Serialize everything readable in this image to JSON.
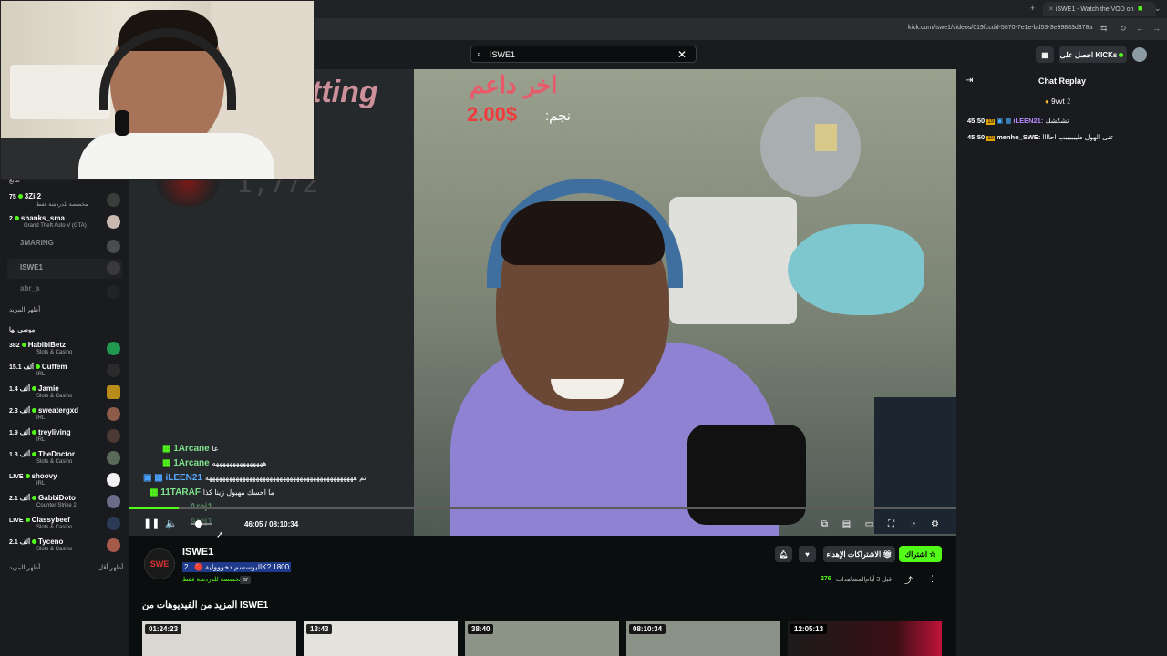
{
  "browser": {
    "tab_title": "iSWE1 - Watch the VOD on",
    "url": "kick.com/iswe1/videos/019fccdd-5870-7e1e-bd53-3e99883d378a"
  },
  "header": {
    "search_value": "ISWE1",
    "get_kicks_label": "احصل على KICKs"
  },
  "sidebar": {
    "following_header": "تتابع",
    "following": [
      {
        "viewers": "75",
        "name": "3Zil2",
        "category": "مخصصة للدردشة فقط"
      },
      {
        "viewers": "2",
        "name": "shanks_sma",
        "category": "Grand Theft Auto V (GTA)"
      },
      {
        "viewers": "",
        "name": "3MARING",
        "category": ""
      },
      {
        "viewers": "",
        "name": "ISWE1",
        "category": ""
      },
      {
        "viewers": "",
        "name": "abr_a",
        "category": ""
      }
    ],
    "show_more_1": "أظهر المزيد",
    "recommended_header": "موصى بها",
    "recommended": [
      {
        "viewers": "382",
        "name": "HabibiBetz",
        "category": "Slots & Casino"
      },
      {
        "viewers": "15.1 ألف",
        "name": "Cuffem",
        "category": "IRL"
      },
      {
        "viewers": "1.4 ألف",
        "name": "Jamie",
        "category": "Slots & Casino"
      },
      {
        "viewers": "2.3 ألف",
        "name": "sweatergxd",
        "category": "IRL"
      },
      {
        "viewers": "1.9 ألف",
        "name": "treyliving",
        "category": "IRL"
      },
      {
        "viewers": "1.3 ألف",
        "name": "TheDoctor",
        "category": "Slots & Casino"
      },
      {
        "viewers": "LIVE",
        "name": "shoovy",
        "category": "IRL"
      },
      {
        "viewers": "2.1 ألف",
        "name": "GabbiDoto",
        "category": "Counter-Strike 2"
      },
      {
        "viewers": "LIVE",
        "name": "Classybeef",
        "category": "Slots & Casino"
      },
      {
        "viewers": "2.1 ألف",
        "name": "Tyceno",
        "category": "Slots & Casino"
      }
    ],
    "show_more_2": "أظهر المزيد",
    "show_less": "أظهر أقل"
  },
  "video": {
    "overlay_top_title": "اخر داعم",
    "overlay_amount": "2.00$",
    "overlay_star": ":نجم",
    "overlay_corner_text": "tting",
    "overlay_counter": "1,772",
    "time": "46:05 / 08:10:34",
    "chat_overlay": [
      {
        "name": "1Arcane",
        "text": "عا"
      },
      {
        "name": "1Arcane",
        "text": "هههههههههههههههه"
      },
      {
        "name": "iLEEN21",
        "text": "تم ههههههههههههههههههههههههههههههههههههههههههههه"
      },
      {
        "name": "11TARAF",
        "text": "ما احسك مهبول زينا كذا"
      },
      {
        "name": "Arej1",
        "text": ""
      },
      {
        "name": "Arej1",
        "text": ""
      }
    ]
  },
  "channel": {
    "name": "ISWE1",
    "title": "اليوسسم دخووولية 🔴 | 2K? 1800",
    "category": "مخصصة للدردشة فقط",
    "lang": "ar",
    "views": "276",
    "views_label": "المشاهدات",
    "ago": "قبل 3 أيام",
    "subscribe_label": "اشتراك",
    "gift_label": "الاشتراكات الإهداء"
  },
  "more_videos": {
    "heading": "المزيد من الفيديوهات من ISWE1",
    "durations": [
      "01:24:23",
      "13:43",
      "38:40",
      "08:10:34",
      "12:05:13"
    ]
  },
  "chat": {
    "title": "Chat Replay",
    "pinned_user": "9vvt",
    "pinned_count": "2",
    "messages": [
      {
        "time": "45:50",
        "badge": "19",
        "user": "iLEEN21:",
        "text": "تشكشك"
      },
      {
        "time": "45:50",
        "badge": "10",
        "user": "menho_SWE:",
        "text": "عنى الهول طيبببببب احاااا"
      }
    ]
  },
  "colors": {
    "kick_green": "#53fc18",
    "bg": "#0b0e0f",
    "panel": "#191b1f"
  }
}
